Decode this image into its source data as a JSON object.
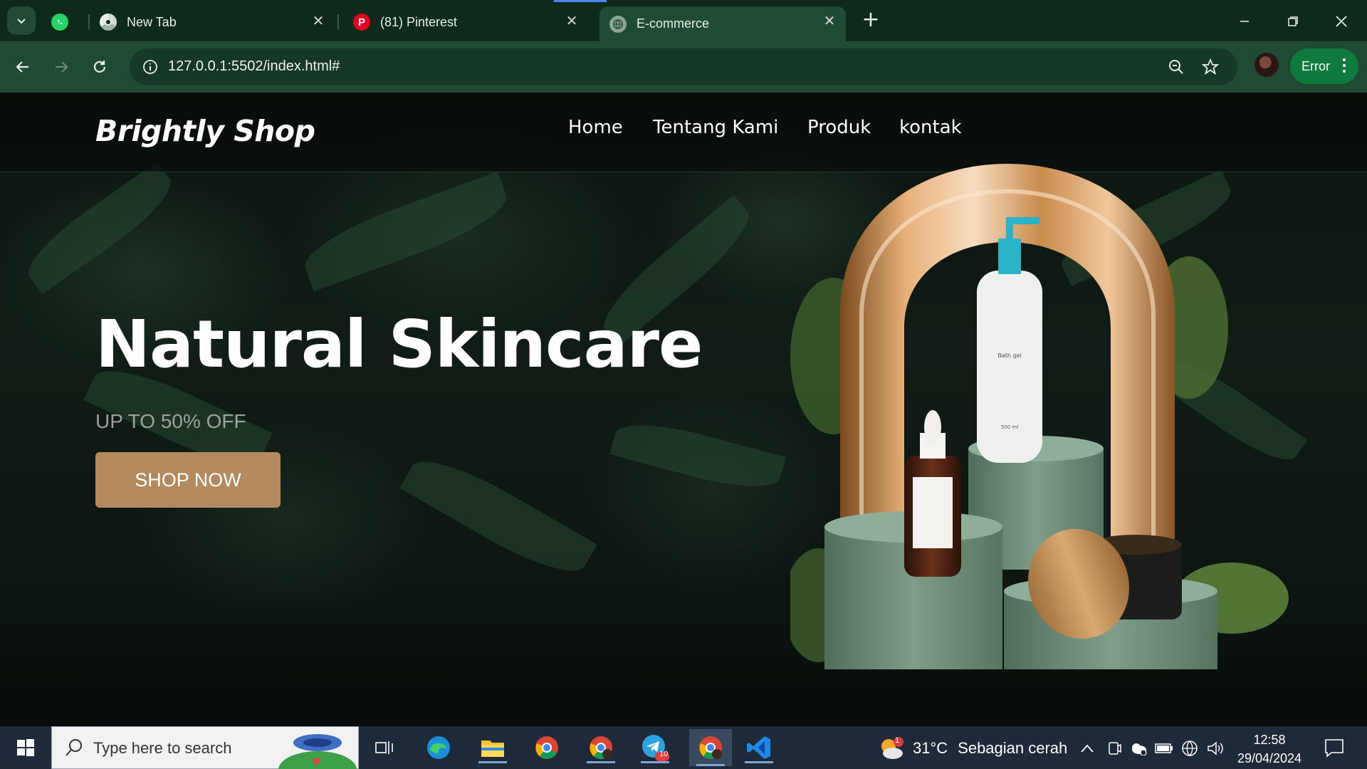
{
  "browser": {
    "tabs": [
      {
        "label": "",
        "icon": "whatsapp-icon"
      },
      {
        "label": "New Tab",
        "icon": "chrome-icon"
      },
      {
        "label": "(81) Pinterest",
        "icon": "pinterest-icon"
      },
      {
        "label": "E-commerce",
        "icon": "globe-icon",
        "active": true
      }
    ],
    "url": "127.0.0.1:5502/index.html#",
    "profile_status": "Error"
  },
  "site": {
    "logo": "Brightly Shop",
    "nav": [
      "Home",
      "Tentang Kami",
      "Produk",
      "kontak"
    ],
    "hero": {
      "title": "Natural Skincare",
      "subtitle": "UP TO 50% OFF",
      "cta": "SHOP NOW"
    },
    "product_labels": {
      "bottle_label": "Bath gel",
      "bottle_volume": "500 ml"
    },
    "colors": {
      "accent": "#b38a5e",
      "header_bg": "#080c0a"
    }
  },
  "taskbar": {
    "search_placeholder": "Type here to search",
    "weather": {
      "temp": "31°C",
      "desc": "Sebagian cerah",
      "badge": "1"
    },
    "telegram_badge": "10",
    "time": "12:58",
    "date": "29/04/2024"
  }
}
